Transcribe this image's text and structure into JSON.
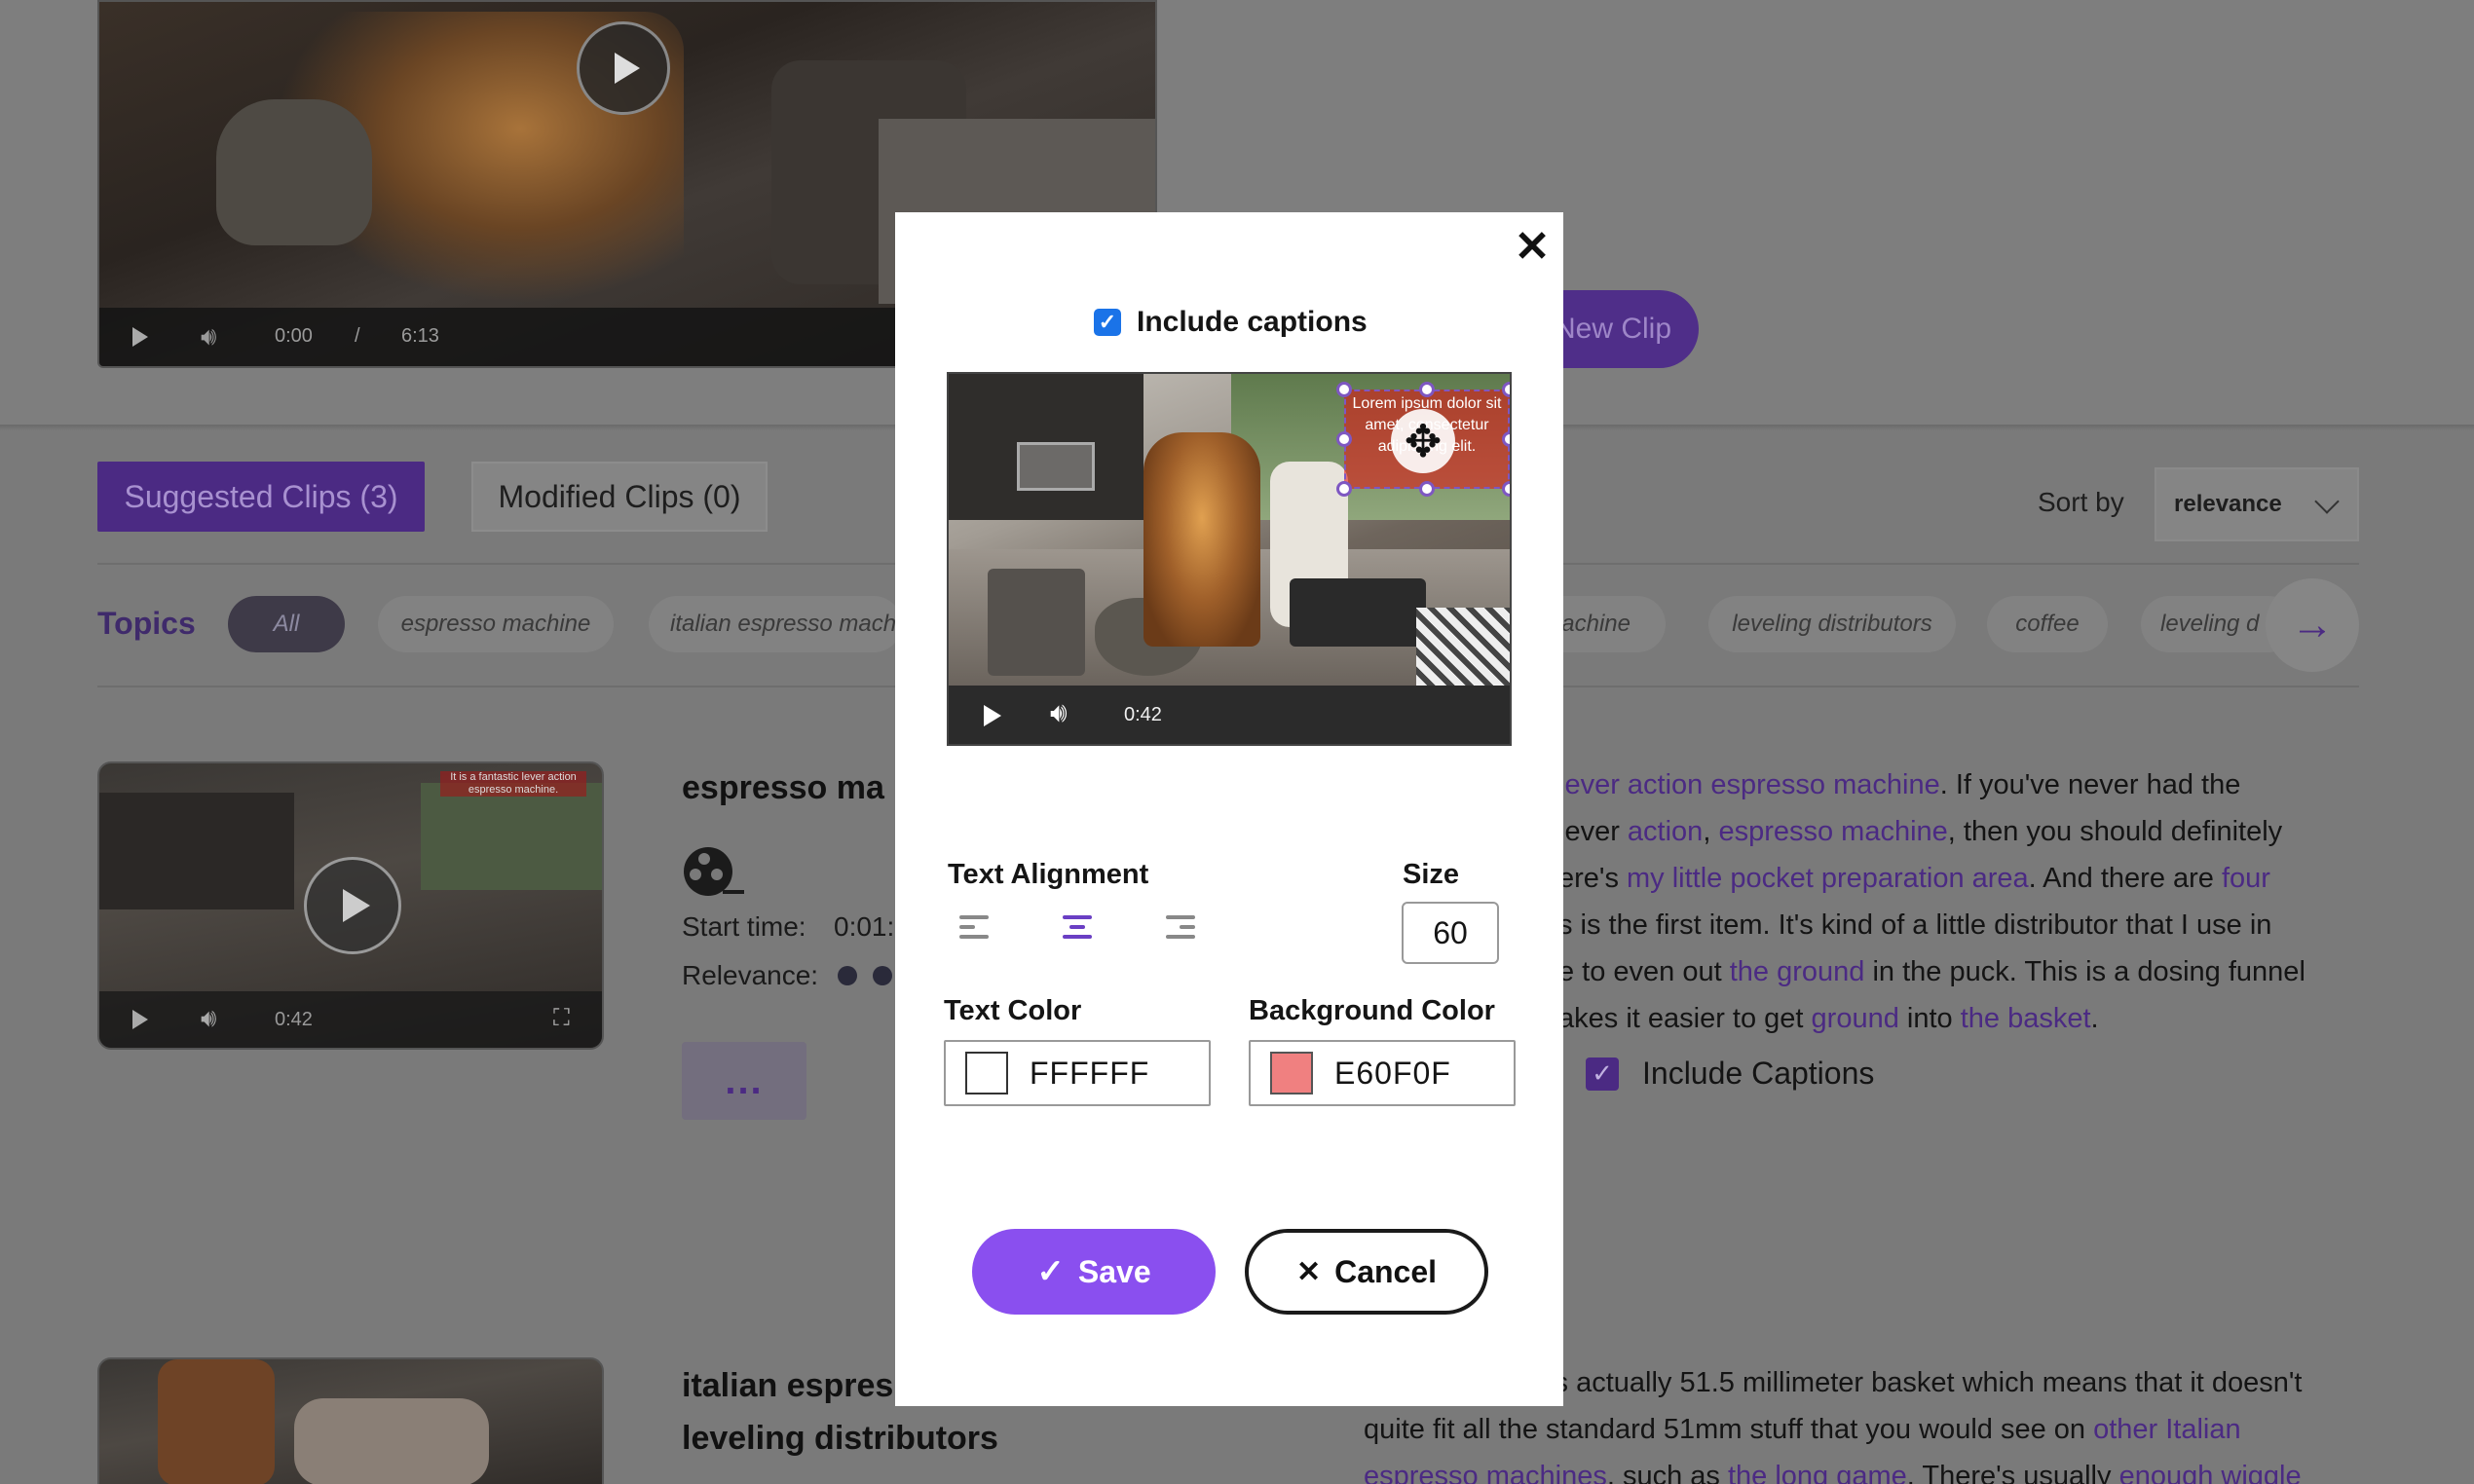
{
  "background": {
    "main_video": {
      "time_current": "0:00",
      "time_separator": "/",
      "time_total": "6:13"
    },
    "new_clip_label": "New Clip",
    "tabs": {
      "suggested": "Suggested Clips (3)",
      "modified": "Modified Clips (0)"
    },
    "sort": {
      "label": "Sort by",
      "value": "relevance"
    },
    "topics": {
      "label": "Topics",
      "chips": [
        "All",
        "espresso machine",
        "italian espresso mach",
        "machine",
        "leveling distributors",
        "coffee",
        "leveling d"
      ]
    },
    "clips": [
      {
        "title": "espresso ma",
        "thumb_caption": "It is a fantastic lever action espresso machine.",
        "thumb_time": "0:42",
        "start_label": "Start time:",
        "start_value": "0:01:",
        "relevance_label": "Relevance:",
        "more_label": "...",
        "transcript": [
          {
            "text": "lever action espresso machine",
            "k": true
          },
          {
            "text": ". If you've never had the",
            "k": false
          },
          {
            "text": " lever ",
            "k": false
          },
          {
            "text": "action",
            "k": true
          },
          {
            "text": ", ",
            "k": false
          },
          {
            "text": "espresso machine",
            "k": true
          },
          {
            "text": ", then you should definitely",
            "k": false
          },
          {
            "text": "ere's ",
            "k": false
          },
          {
            "text": "my little pocket preparation area",
            "k": true
          },
          {
            "text": ". And there are ",
            "k": false
          },
          {
            "text": "four",
            "k": true
          },
          {
            "text": "s is the first item. It's kind of a little distributor that I use in",
            "k": false
          },
          {
            "text": "e to even out ",
            "k": false
          },
          {
            "text": "the ground",
            "k": true
          },
          {
            "text": " in the puck. This is a dosing funnel",
            "k": false
          },
          {
            "text": "akes it easier to get ",
            "k": false
          },
          {
            "text": "ground",
            "k": true
          },
          {
            "text": " into ",
            "k": false
          },
          {
            "text": "the basket",
            "k": true
          },
          {
            "text": ".",
            "k": false
          }
        ],
        "include_captions_label": "Include Captions"
      },
      {
        "title_line1": "italian espres",
        "title_line2": "leveling distributors",
        "transcript_line1": "'s actually 51.5 millimeter basket which means that it doesn't",
        "transcript_line2_a": "quite fit all the standard 51mm stuff that you would see on ",
        "transcript_line2_k": "other Italian",
        "transcript_line3_k1": "espresso machines",
        "transcript_line3_a": ", such as ",
        "transcript_line3_k2": "the long game",
        "transcript_line3_b": ". There's usually ",
        "transcript_line3_k3": "enough wiggle"
      }
    ]
  },
  "modal": {
    "close_icon": "close-icon",
    "include_captions_label": "Include captions",
    "include_captions_checked": true,
    "preview": {
      "caption_text": "Lorem ipsum dolor sit amet, consectetur adipiscing elit.",
      "time": "0:42"
    },
    "text_alignment_label": "Text Alignment",
    "alignment_selected": "center",
    "size_label": "Size",
    "size_value": "60",
    "text_color_label": "Text Color",
    "text_color_value": "FFFFFF",
    "text_color_hex": "#FFFFFF",
    "background_color_label": "Background Color",
    "background_color_value": "E60F0F",
    "background_color_hex": "#E60F0F",
    "save_label": "Save",
    "cancel_label": "Cancel",
    "accent": "#8A4FEF"
  }
}
